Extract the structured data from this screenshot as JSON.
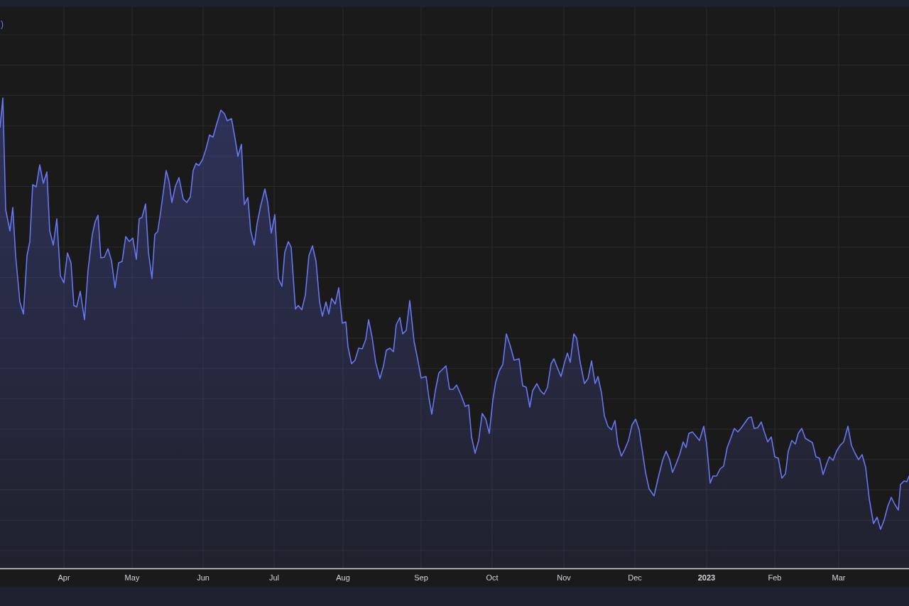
{
  "legend": {
    "text": ")"
  },
  "x_axis": {
    "labels": [
      {
        "label": "Apr",
        "emphasized": false
      },
      {
        "label": "May",
        "emphasized": false
      },
      {
        "label": "Jun",
        "emphasized": false
      },
      {
        "label": "Jul",
        "emphasized": false
      },
      {
        "label": "Aug",
        "emphasized": false
      },
      {
        "label": "Sep",
        "emphasized": false
      },
      {
        "label": "Oct",
        "emphasized": false
      },
      {
        "label": "Nov",
        "emphasized": false
      },
      {
        "label": "Dec",
        "emphasized": false
      },
      {
        "label": "2023",
        "emphasized": true
      },
      {
        "label": "Feb",
        "emphasized": false
      },
      {
        "label": "Mar",
        "emphasized": false
      }
    ]
  }
}
